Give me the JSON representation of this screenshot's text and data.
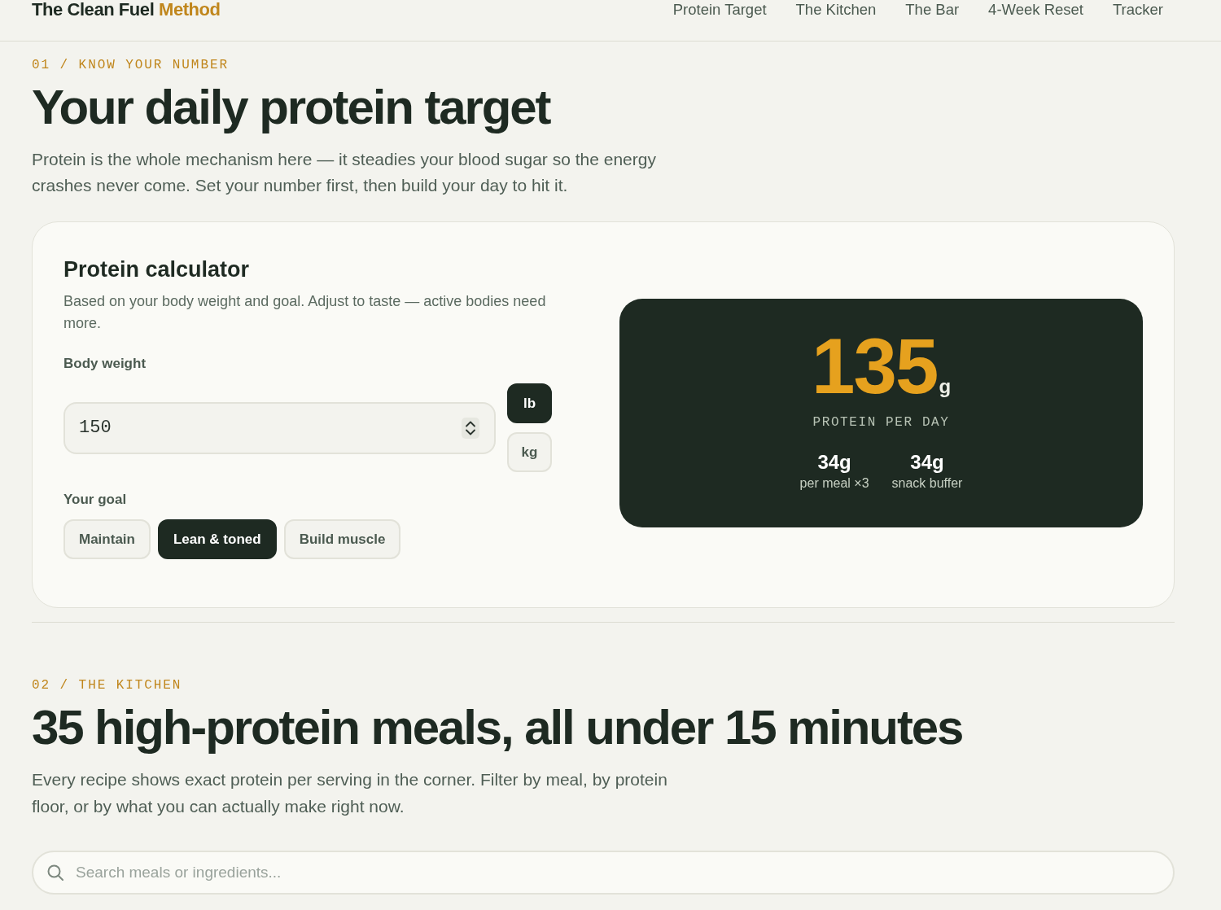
{
  "header": {
    "logo": {
      "text": "The Clean Fuel",
      "accent": "Method"
    },
    "nav": [
      "Protein Target",
      "The Kitchen",
      "The Bar",
      "4-Week Reset",
      "Tracker"
    ]
  },
  "protein_section": {
    "eyebrow": "01 / KNOW YOUR NUMBER",
    "title": "Your daily protein target",
    "intro": "Protein is the whole mechanism here — it steadies your blood sugar so the energy crashes never come. Set your number first, then build your day to hit it.",
    "calculator": {
      "title": "Protein calculator",
      "description": "Based on your body weight and goal. Adjust to taste — active bodies need more.",
      "weight_label": "Body weight",
      "weight_value": "150",
      "units": [
        {
          "label": "lb",
          "selected": true
        },
        {
          "label": "kg",
          "selected": false
        }
      ],
      "goal_label": "Your goal",
      "goals": [
        {
          "label": "Maintain",
          "selected": false
        },
        {
          "label": "Lean & toned",
          "selected": true
        },
        {
          "label": "Build muscle",
          "selected": false
        }
      ],
      "result": {
        "value": "135",
        "unit": "g",
        "caption": "PROTEIN PER DAY",
        "stats": [
          {
            "value": "34g",
            "label": "per meal ×3"
          },
          {
            "value": "34g",
            "label": "snack buffer"
          }
        ]
      }
    }
  },
  "kitchen_section": {
    "eyebrow": "02 / THE KITCHEN",
    "title": "35 high-protein meals, all under 15 minutes",
    "intro": "Every recipe shows exact protein per serving in the corner. Filter by meal, by protein floor, or by what you can actually make right now.",
    "search": {
      "placeholder": "Search meals or ingredients..."
    }
  }
}
